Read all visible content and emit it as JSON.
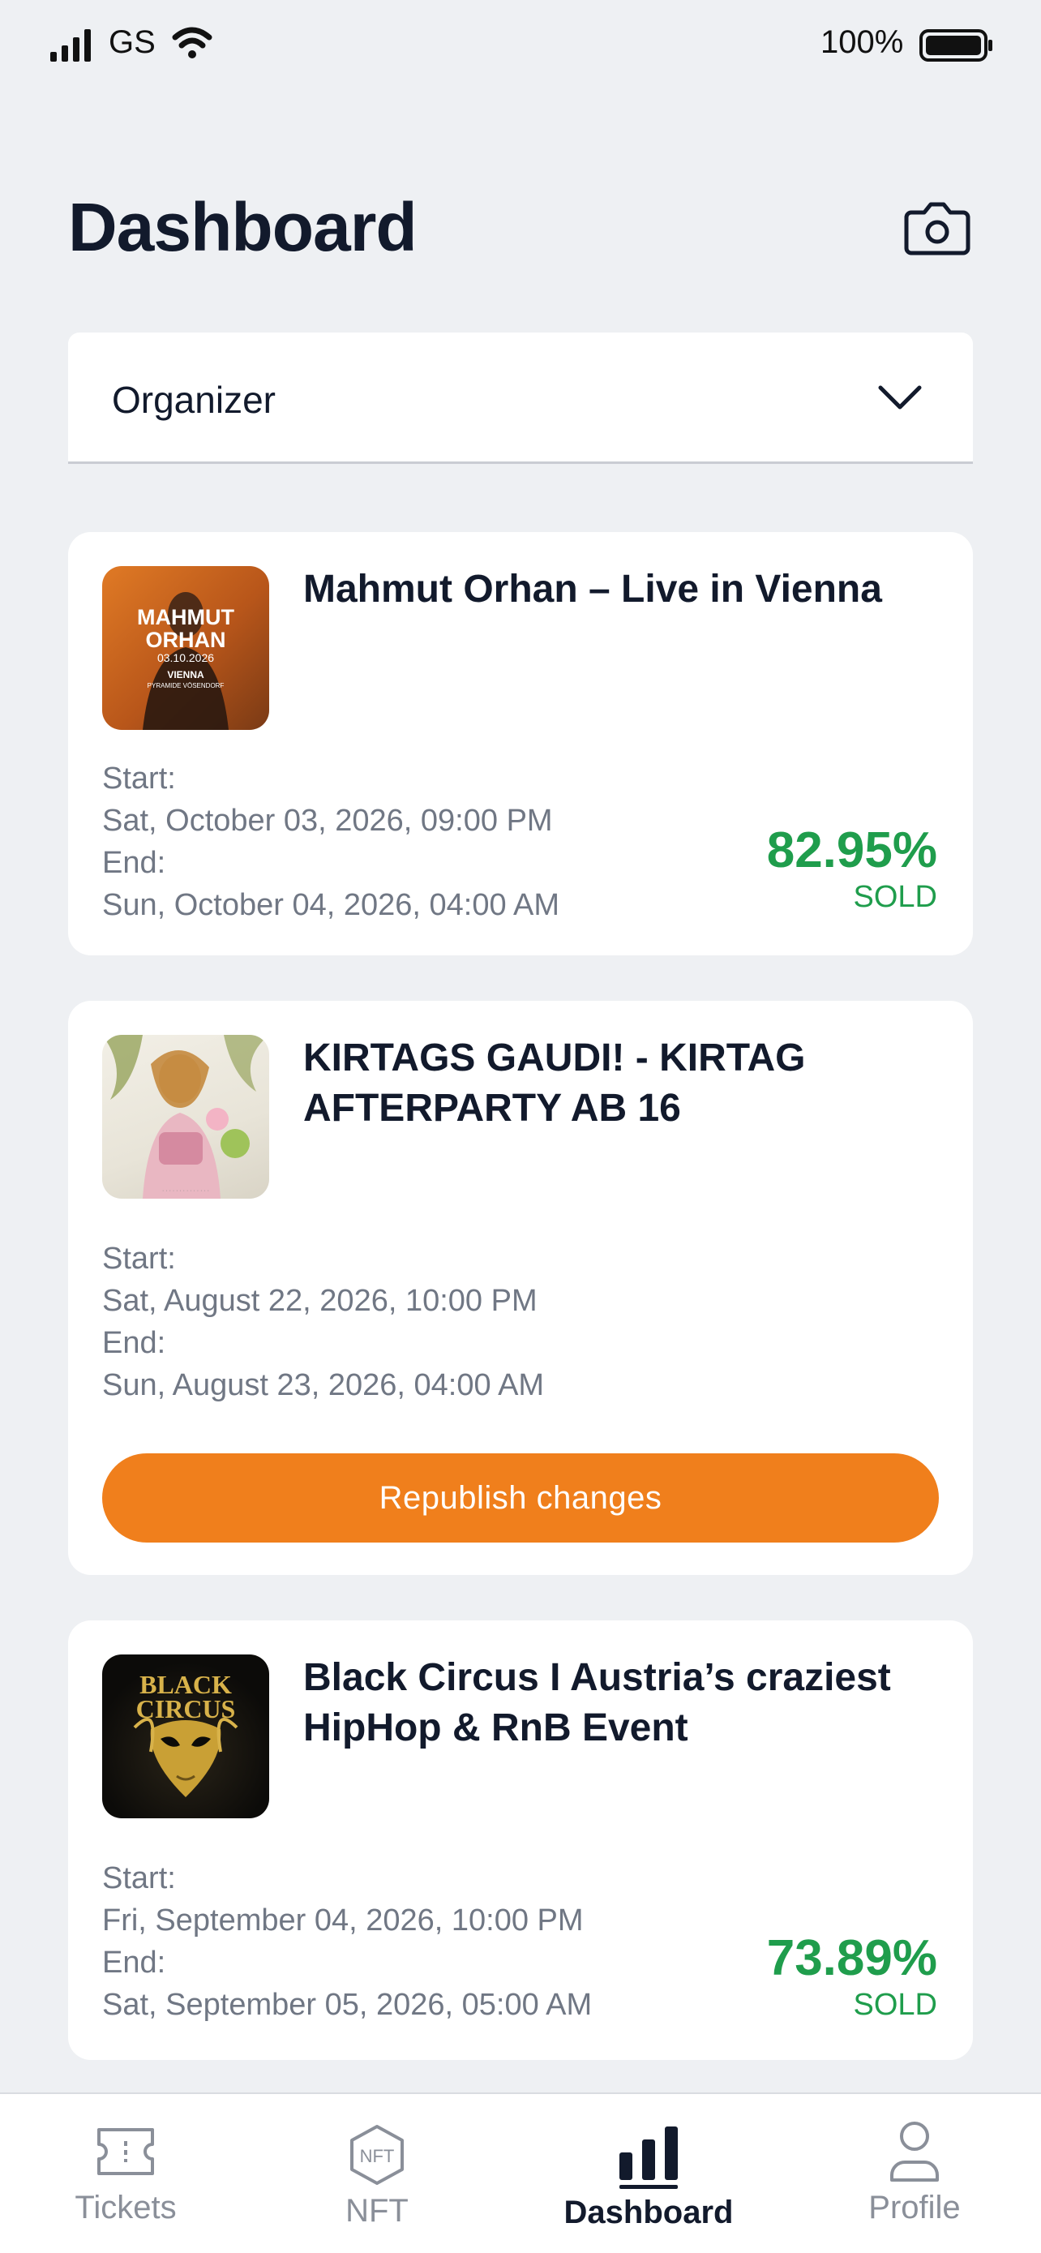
{
  "status_bar": {
    "carrier": "GS",
    "battery": "100%"
  },
  "header": {
    "title": "Dashboard",
    "action_icon": "camera-icon"
  },
  "filter": {
    "selected": "Organizer",
    "icon": "chevron-down-icon"
  },
  "events": [
    {
      "title": "Mahmut Orhan – Live in Vienna",
      "poster": {
        "line1": "MAHMUT",
        "line2": "ORHAN",
        "date": "03.10.2026",
        "city": "VIENNA",
        "venue": "PYRAMIDE VÖSENDORF"
      },
      "start_label": "Start:",
      "start": "Sat, October 03, 2026, 09:00 PM",
      "end_label": "End:",
      "end": "Sun, October 04, 2026, 04:00 AM",
      "sold_pct": "82.95%",
      "sold_label": "SOLD"
    },
    {
      "title": "KIRTAGS GAUDI! - KIRTAG AFTERPARTY AB 16",
      "start_label": "Start:",
      "start": "Sat, August 22, 2026, 10:00 PM",
      "end_label": "End:",
      "end": "Sun, August 23, 2026, 04:00 AM",
      "action_label": "Republish changes"
    },
    {
      "title": "Black Circus I Austria’s craziest HipHop & RnB Event",
      "poster": {
        "line1": "BLACK",
        "line2": "CIRCUS"
      },
      "start_label": "Start:",
      "start": "Fri, September 04, 2026, 10:00 PM",
      "end_label": "End:",
      "end": "Sat, September 05, 2026, 05:00 AM",
      "sold_pct": "73.89%",
      "sold_label": "SOLD"
    }
  ],
  "nav": [
    {
      "label": "Tickets",
      "icon": "ticket-icon"
    },
    {
      "label": "NFT",
      "icon": "nft-icon"
    },
    {
      "label": "Dashboard",
      "icon": "bar-chart-icon",
      "active": true
    },
    {
      "label": "Profile",
      "icon": "user-icon"
    }
  ],
  "colors": {
    "accent": "#f07f1c",
    "sold": "#1f9d4c",
    "text": "#121a2c",
    "muted": "#707784",
    "background": "#eef0f3"
  }
}
